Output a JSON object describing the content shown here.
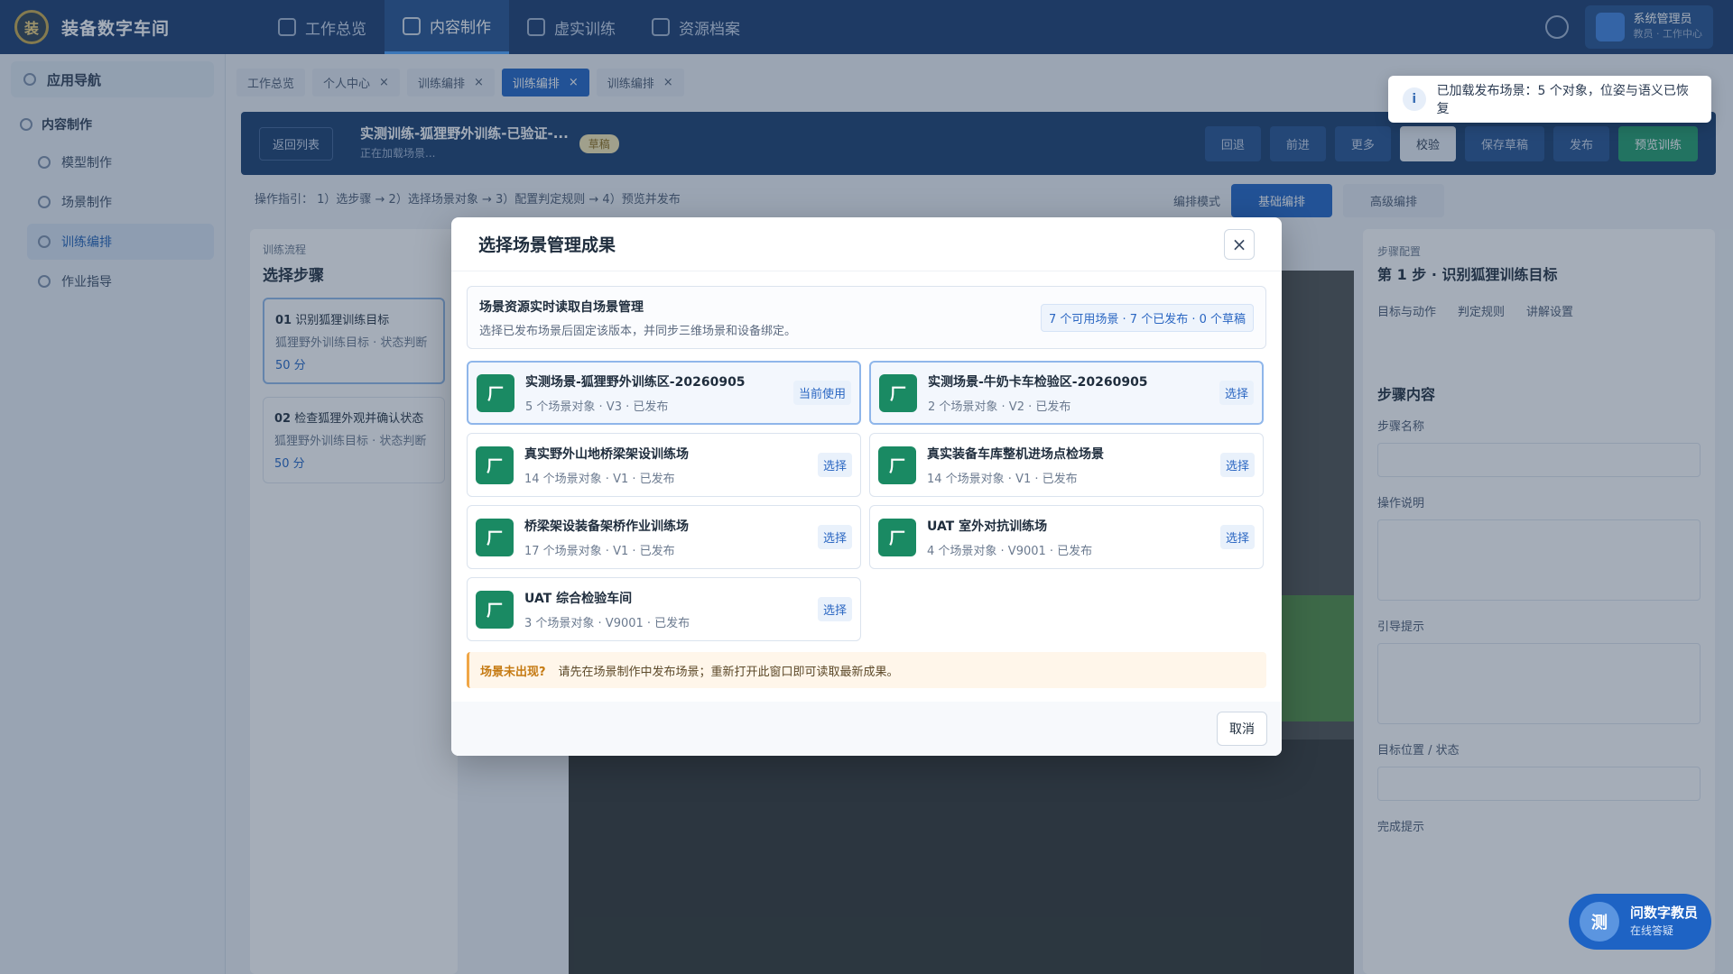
{
  "app": {
    "logo_text": "装",
    "title": "装备数字车间"
  },
  "topnav": [
    {
      "label": "工作总览",
      "active": false
    },
    {
      "label": "内容制作",
      "active": true
    },
    {
      "label": "虚实训练",
      "active": false
    },
    {
      "label": "资源档案",
      "active": false
    }
  ],
  "user": {
    "name": "系统管理员",
    "role": "教员 · 工作中心"
  },
  "sidebar": {
    "header": "应用导航",
    "group": "内容制作",
    "items": [
      {
        "label": "模型制作",
        "active": false
      },
      {
        "label": "场景制作",
        "active": false
      },
      {
        "label": "训练编排",
        "active": true
      },
      {
        "label": "作业指导",
        "active": false
      }
    ]
  },
  "tabs": [
    {
      "label": "工作总览",
      "active": false
    },
    {
      "label": "个人中心",
      "active": false
    },
    {
      "label": "训练编排",
      "active": false
    },
    {
      "label": "训练编排",
      "active": true
    },
    {
      "label": "训练编排",
      "active": false
    }
  ],
  "editor": {
    "back": "返回列表",
    "title": "实测训练-狐狸野外训练-已验证-...",
    "subtitle": "正在加载场景...",
    "draft": "草稿",
    "actions": [
      "回退",
      "前进",
      "更多",
      "校验",
      "保存草稿",
      "发布",
      "预览训练"
    ],
    "stepline": "操作指引： 1）选步骤 → 2）选择场景对象 → 3）配置判定规则 → 4）预览并发布",
    "mode_label": "编排模式",
    "mode_on": "基础编排",
    "mode_off": "高级编排"
  },
  "left_panel": {
    "small": "训练流程",
    "title": "选择步骤",
    "steps": [
      {
        "no": "01",
        "name": "识别狐狸训练目标",
        "desc": "狐狸野外训练目标 · 状态判断",
        "score": "50 分"
      },
      {
        "no": "02",
        "name": "检查狐狸外观并确认状态",
        "desc": "狐狸野外训练目标 · 状态判断",
        "score": "50 分"
      }
    ]
  },
  "right_panel": {
    "small": "步骤配置",
    "title": "第 1 步 · 识别狐狸训练目标",
    "tabs": [
      "目标与动作",
      "判定规则",
      "讲解设置"
    ],
    "section": "步骤内容",
    "fields": [
      "步骤名称",
      "操作说明",
      "引导提示",
      "目标位置 / 状态",
      "完成提示"
    ]
  },
  "toast": {
    "icon": "i",
    "text": "已加载发布场景：5 个对象，位姿与语义已恢复"
  },
  "chat": {
    "avatar": "测",
    "title": "问数字教员",
    "sub": "在线答疑"
  },
  "modal": {
    "title": "选择场景管理成果",
    "close": "×",
    "source": {
      "title": "场景资源实时读取自场景管理",
      "subtitle": "选择已发布场景后固定该版本，并同步三维场景和设备绑定。",
      "count": "7 个可用场景 · 7 个已发布 · 0 个草稿"
    },
    "scenes": [
      {
        "icon": "厂",
        "name": "实测场景-狐狸野外训练区-20260905",
        "meta": "5 个场景对象 · V3 · 已发布",
        "action": "当前使用",
        "selected": true
      },
      {
        "icon": "厂",
        "name": "实测场景-牛奶卡车检验区-20260905",
        "meta": "2 个场景对象 · V2 · 已发布",
        "action": "选择",
        "selected": true
      },
      {
        "icon": "厂",
        "name": "真实野外山地桥梁架设训练场",
        "meta": "14 个场景对象 · V1 · 已发布",
        "action": "选择",
        "selected": false
      },
      {
        "icon": "厂",
        "name": "真实装备车库整机进场点检场景",
        "meta": "14 个场景对象 · V1 · 已发布",
        "action": "选择",
        "selected": false
      },
      {
        "icon": "厂",
        "name": "桥梁架设装备架桥作业训练场",
        "meta": "17 个场景对象 · V1 · 已发布",
        "action": "选择",
        "selected": false
      },
      {
        "icon": "厂",
        "name": "UAT 室外对抗训练场",
        "meta": "4 个场景对象 · V9001 · 已发布",
        "action": "选择",
        "selected": false
      },
      {
        "icon": "厂",
        "name": "UAT 综合检验车间",
        "meta": "3 个场景对象 · V9001 · 已发布",
        "action": "选择",
        "selected": false
      }
    ],
    "warn_title": "场景未出现?",
    "warn_text": "请先在场景制作中发布场景；重新打开此窗口即可读取最新成果。",
    "cancel": "取消"
  },
  "colors": {
    "brand": "#173a6e",
    "accent": "#1e63c4",
    "scene_icon": "#1a8a63",
    "warn": "#f0a646"
  }
}
